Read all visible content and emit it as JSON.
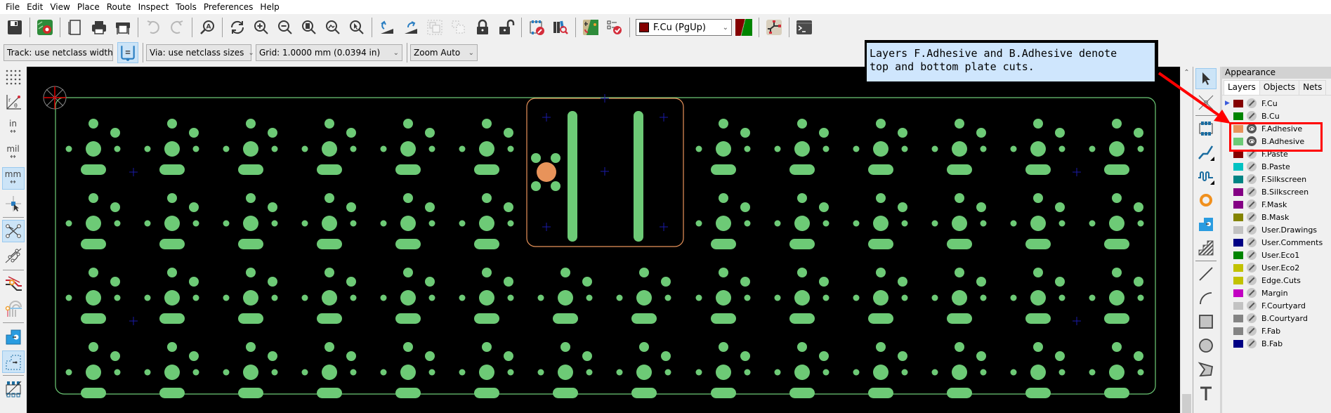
{
  "menu": [
    "File",
    "Edit",
    "View",
    "Place",
    "Route",
    "Inspect",
    "Tools",
    "Preferences",
    "Help"
  ],
  "toolbar": {
    "active_layer": "F.Cu (PgUp)",
    "active_layer_color": "#840000",
    "icons": [
      "save-icon",
      "board-setup-icon",
      "page-settings-icon",
      "print-icon",
      "plot-icon",
      "undo-icon",
      "redo-icon",
      "find-icon",
      "redraw-icon",
      "zoom-in-icon",
      "zoom-out-icon",
      "zoom-fit-icon",
      "zoom-objects-icon",
      "zoom-selection-icon",
      "rotate-ccw-icon",
      "rotate-cw-icon",
      "group-icon",
      "ungroup-icon",
      "lock-icon",
      "unlock-icon",
      "footprint-editor-icon",
      "footprint-browser-icon",
      "update-pcb-icon",
      "drc-icon",
      "layer-pair-icon",
      "schematic-icon",
      "scripting-console-icon"
    ]
  },
  "toolbar2": {
    "track": "Track: use netclass width",
    "via": "Via: use netclass sizes",
    "grid": "Grid: 1.0000 mm (0.0394 in)",
    "zoom": "Zoom Auto"
  },
  "left_toolbar": {
    "in_label": "in",
    "mil_label": "mil",
    "mm_label": "mm"
  },
  "appearance": {
    "title": "Appearance",
    "tabs": [
      "Layers",
      "Objects",
      "Nets"
    ],
    "active_tab": "Layers",
    "layers": [
      {
        "name": "F.Cu",
        "color": "#840000",
        "visible": false,
        "current": true
      },
      {
        "name": "B.Cu",
        "color": "#008400",
        "visible": false
      },
      {
        "name": "F.Adhesive",
        "color": "#e8935a",
        "visible": true
      },
      {
        "name": "B.Adhesive",
        "color": "#6dca76",
        "visible": true
      },
      {
        "name": "F.Paste",
        "color": "#840000",
        "visible": false
      },
      {
        "name": "B.Paste",
        "color": "#00c2c2",
        "visible": false
      },
      {
        "name": "F.Silkscreen",
        "color": "#008484",
        "visible": false
      },
      {
        "name": "B.Silkscreen",
        "color": "#840084",
        "visible": false
      },
      {
        "name": "F.Mask",
        "color": "#840084",
        "visible": false
      },
      {
        "name": "B.Mask",
        "color": "#848400",
        "visible": false
      },
      {
        "name": "User.Drawings",
        "color": "#c2c2c2",
        "visible": false
      },
      {
        "name": "User.Comments",
        "color": "#000084",
        "visible": false
      },
      {
        "name": "User.Eco1",
        "color": "#008400",
        "visible": false
      },
      {
        "name": "User.Eco2",
        "color": "#c2c200",
        "visible": false
      },
      {
        "name": "Edge.Cuts",
        "color": "#c2c200",
        "visible": false
      },
      {
        "name": "Margin",
        "color": "#c200c2",
        "visible": false
      },
      {
        "name": "F.Courtyard",
        "color": "#c2c2c2",
        "visible": false
      },
      {
        "name": "B.Courtyard",
        "color": "#848484",
        "visible": false
      },
      {
        "name": "F.Fab",
        "color": "#848484",
        "visible": false
      },
      {
        "name": "B.Fab",
        "color": "#000084",
        "visible": false
      }
    ]
  },
  "annotation": {
    "text": "Layers F.Adhesive and B.Adhesive denote\ntop and bottom plate cuts."
  },
  "pcb": {
    "board_outline_color": "#6dca76",
    "pad_color": "#6dca76",
    "cutout_color": "#e8935a",
    "marker_color": "#1a1aa8",
    "rows": 4,
    "left_switch_columns": 6,
    "right_switch_columns": 6,
    "bottom_switch_columns_center": 2
  }
}
